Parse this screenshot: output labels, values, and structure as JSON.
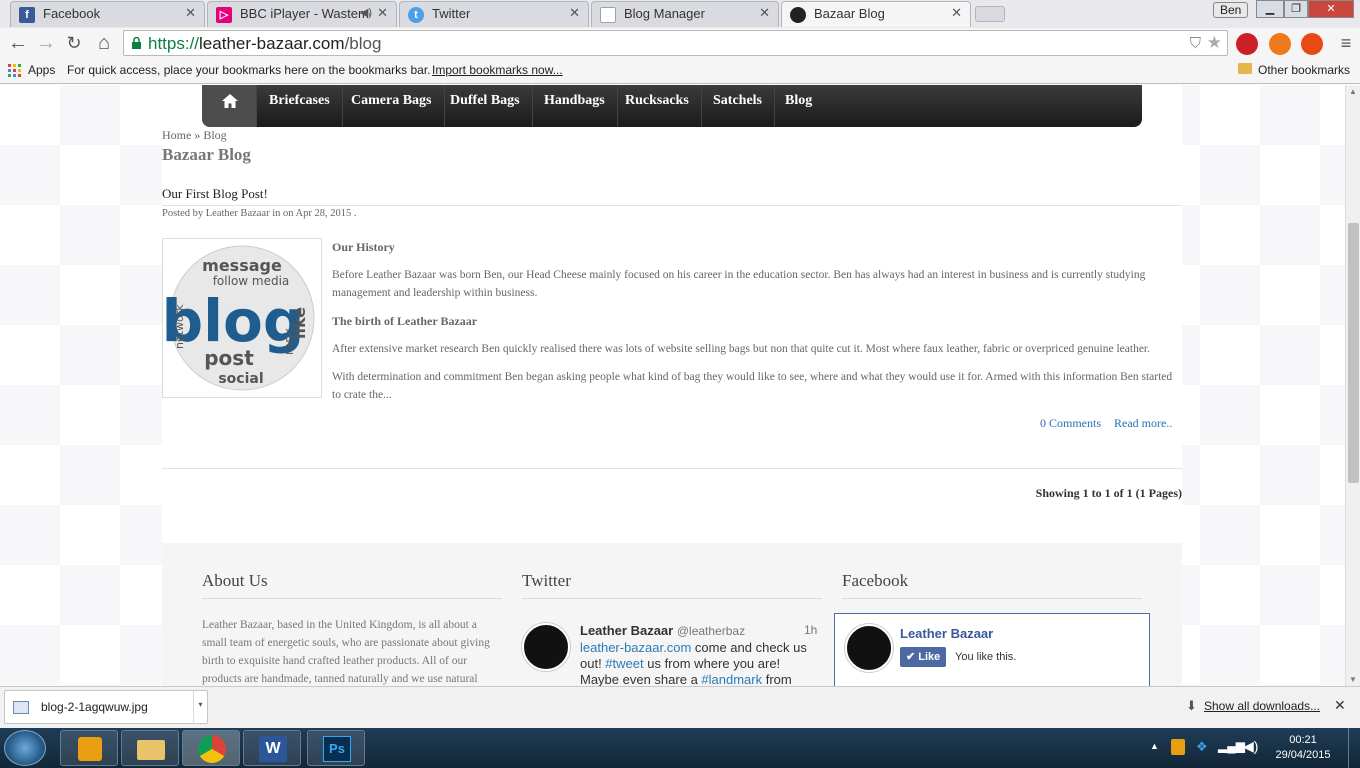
{
  "browser": {
    "tabs": [
      {
        "label": "Facebook",
        "icon": "facebook-icon",
        "color": "#3b5998",
        "glyph": "f"
      },
      {
        "label": "BBC iPlayer - Wasteme",
        "icon": "iplayer-icon",
        "color": "#e6007e",
        "glyph": "▷"
      },
      {
        "label": "Twitter",
        "icon": "twitter-icon",
        "color": "#4a9fe8",
        "glyph": "t"
      },
      {
        "label": "Blog Manager",
        "icon": "page-icon",
        "color": "#9aa3ad",
        "glyph": ""
      },
      {
        "label": "Bazaar Blog",
        "icon": "bazaar-icon",
        "color": "#222222",
        "glyph": "●"
      }
    ],
    "profile_label": "Ben",
    "url_scheme": "https://",
    "url_host": "leather-bazaar.com",
    "url_path": "/blog",
    "bookmarks": {
      "apps_label": "Apps",
      "hint": "For quick access, place your bookmarks here on the bookmarks bar.",
      "import_link": "Import bookmarks now...",
      "other": "Other bookmarks"
    }
  },
  "site": {
    "nav": [
      "Briefcases",
      "Camera Bags",
      "Duffel Bags",
      "Handbags",
      "Rucksacks",
      "Satchels",
      "Blog"
    ],
    "breadcrumb": "Home » Blog",
    "page_title": "Bazaar Blog",
    "post": {
      "title": "Our First Blog Post!",
      "meta": "Posted by Leather Bazaar in on Apr 28, 2015 .",
      "history_heading": "Our History",
      "history_text": "Before Leather Bazaar was born Ben, our Head Cheese mainly focused on his career in the education sector. Ben has always had an interest in business and is currently studying management and leadership within business.",
      "birth_heading": "The birth of Leather Bazaar",
      "birth_text": "After extensive market research Ben quickly realised there was lots of website selling bags but non that quite cut it. Most where faux leather, fabric or overpriced genuine leather.",
      "determination_text": "With determination and commitment Ben began asking people what kind of bag they would like to see, where and what they would use it for. Armed with this information Ben started to crate the...",
      "comments_link": "0 Comments",
      "read_more": "Read more.."
    },
    "pagination": "Showing 1 to 1 of 1 (1 Pages)",
    "footer": {
      "about_heading": "About Us",
      "about_text": "Leather Bazaar, based in the United Kingdom, is all about a small team of energetic souls, who are passionate about giving birth to exquisite hand crafted leather products. All of our products are handmade, tanned naturally and we use natural",
      "twitter_heading": "Twitter",
      "tweet_name": "Leather Bazaar",
      "tweet_handle": "@leatherbaz",
      "tweet_time": "1h",
      "tweet_link": "leather-bazaar.com",
      "tweet_text1": " come and check us out! ",
      "tweet_tag": "#tweet",
      "tweet_text2": " us from where you are! Maybe even share a ",
      "tweet_tag2": "#landmark",
      "tweet_text3": " from",
      "facebook_heading": "Facebook",
      "fb_name": "Leather Bazaar",
      "fb_like": "Like",
      "fb_you_like": "You like this."
    }
  },
  "downloads": {
    "file": "blog-2-1agqwuw.jpg",
    "show_all": "Show all downloads..."
  },
  "taskbar": {
    "time": "00:21",
    "date": "29/04/2015"
  },
  "colors": {
    "link": "#2a6ebb",
    "twitter_link": "#2b7bb9"
  }
}
